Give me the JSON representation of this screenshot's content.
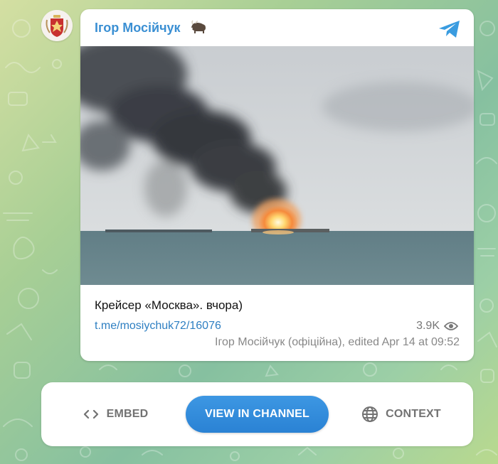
{
  "channel": {
    "name": "Ігор Мосійчук",
    "avatar_icon": "coat-of-arms-avatar",
    "emoji_icon": "bison-emoji"
  },
  "post": {
    "caption": "Крейсер «Москва». вчора)",
    "link": "t.me/mosiychuk72/16076",
    "views": "3.9K",
    "meta": "Ігор Мосійчук (офіційна), edited  Apr 14 at 09:52",
    "image_icon": "ship-on-fire-photo"
  },
  "actions": {
    "embed": "EMBED",
    "view": "VIEW IN CHANNEL",
    "context": "CONTEXT"
  },
  "colors": {
    "accent": "#2a82d4",
    "link": "#2e7fc2",
    "name": "#3a8fd3"
  }
}
